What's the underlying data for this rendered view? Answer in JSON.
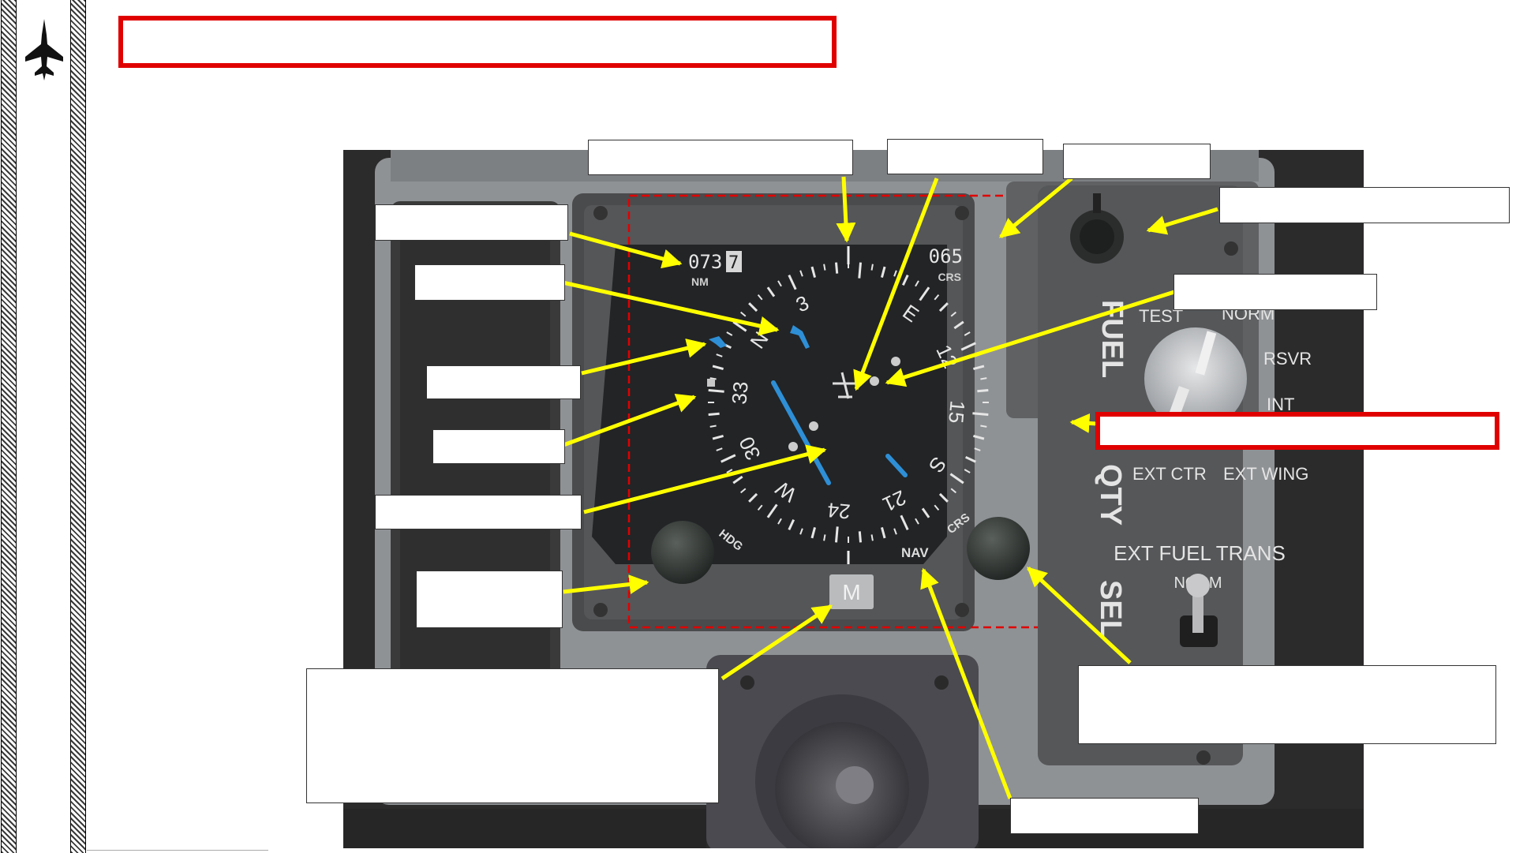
{
  "page": {
    "title": "",
    "fuel_title": "",
    "footer": ""
  },
  "instrument": {
    "distance_value": "073",
    "distance_last_digit": "7",
    "distance_unit": "NM",
    "course_value": "065",
    "course_unit": "CRS",
    "compass_labels": [
      "E",
      "12",
      "15",
      "S",
      "21",
      "24",
      "W",
      "30",
      "33",
      "N",
      "3"
    ],
    "hdg_label": "HDG",
    "crs_label": "CRS",
    "nav_label": "NAV",
    "mode_button_label": "M"
  },
  "fuel_panel": {
    "vertical_label_1": "FUEL",
    "vertical_label_2": "QTY",
    "vertical_label_3": "SEL",
    "positions": [
      "TEST",
      "NORM",
      "RSVR",
      "INT",
      "EXT CTR",
      "EXT WING"
    ],
    "ext_fuel_trans": "EXT FUEL TRANS",
    "ext_fuel_trans_pos": "NORM"
  },
  "callouts": [
    "",
    "",
    "",
    "",
    "",
    "",
    "",
    "",
    "",
    "",
    "",
    "",
    "",
    "",
    ""
  ],
  "colors": {
    "title_border": "#e00000",
    "arrow": "#ffff00",
    "dashed_frame": "#e00000",
    "needle": "#2e8fd6",
    "panel_gray": "#8a8d8f"
  }
}
